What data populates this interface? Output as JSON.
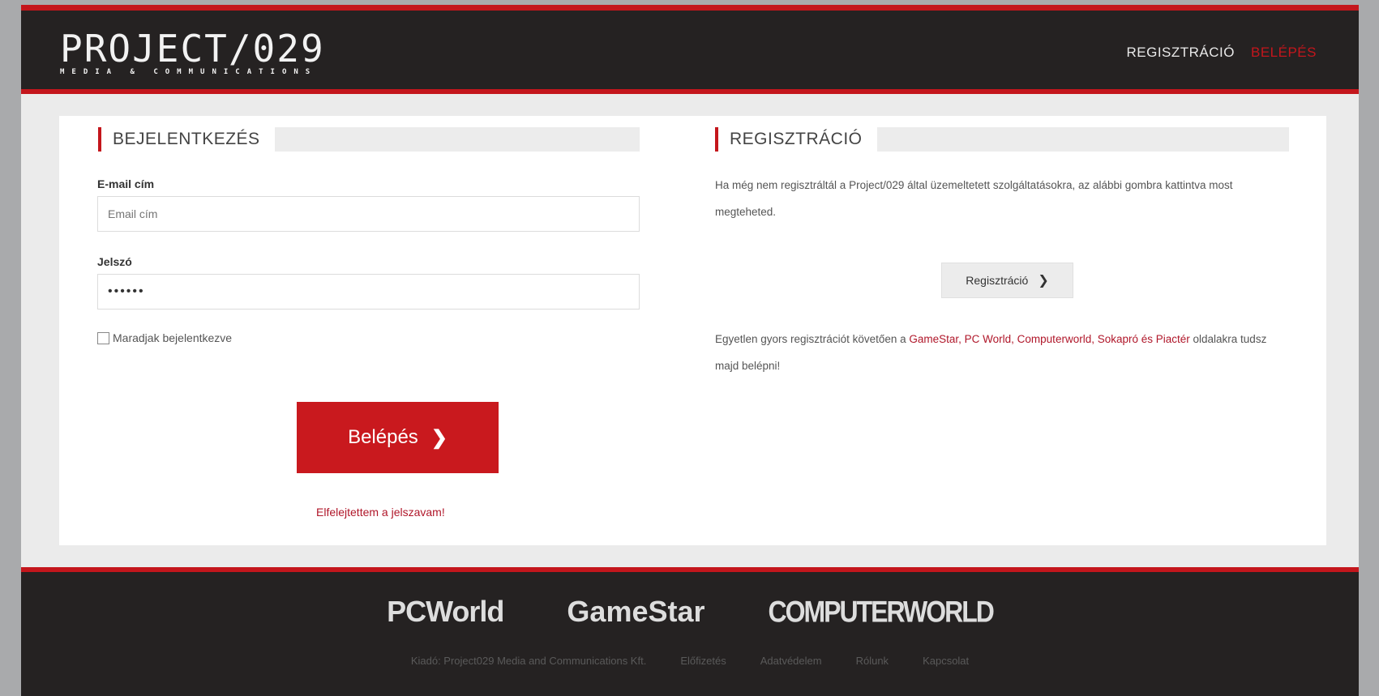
{
  "header": {
    "logo_main": "PROJECT/029",
    "logo_sub": "MEDIA & COMMUNICATIONS",
    "nav": [
      {
        "label": "REGISZTRÁCIÓ",
        "active": false
      },
      {
        "label": "BELÉPÉS",
        "active": true
      }
    ]
  },
  "login": {
    "title": "BEJELENTKEZÉS",
    "email_label": "E-mail cím",
    "email_placeholder": "Email cím",
    "password_label": "Jelszó",
    "password_value": "••••••",
    "remember_label": "Maradjak bejelentkezve",
    "submit_label": "Belépés",
    "forgot_label": "Elfelejtettem a jelszavam!"
  },
  "register": {
    "title": "REGISZTRÁCIÓ",
    "intro": "Ha még nem regisztráltál a Project/029 által üzemeltetett szolgáltatásokra, az alábbi gombra kattintva most megteheted.",
    "button_label": "Regisztráció",
    "info_prefix": "Egyetlen gyors regisztrációt követően a ",
    "info_sites": "GameStar, PC World, Computerworld, Sokapró és Piactér",
    "info_suffix": " oldalakra tudsz majd belépni!"
  },
  "footer": {
    "brands": [
      "PCWorld",
      "GameStar",
      "COMPUTERWORLD"
    ],
    "links": [
      "Kiadó: Project029 Media and Communications Kft.",
      "Előfizetés",
      "Adatvédelem",
      "Rólunk",
      "Kapcsolat"
    ]
  },
  "colors": {
    "accent": "#c4161c",
    "header_bg": "#252222",
    "page_bg": "#ebebeb"
  }
}
